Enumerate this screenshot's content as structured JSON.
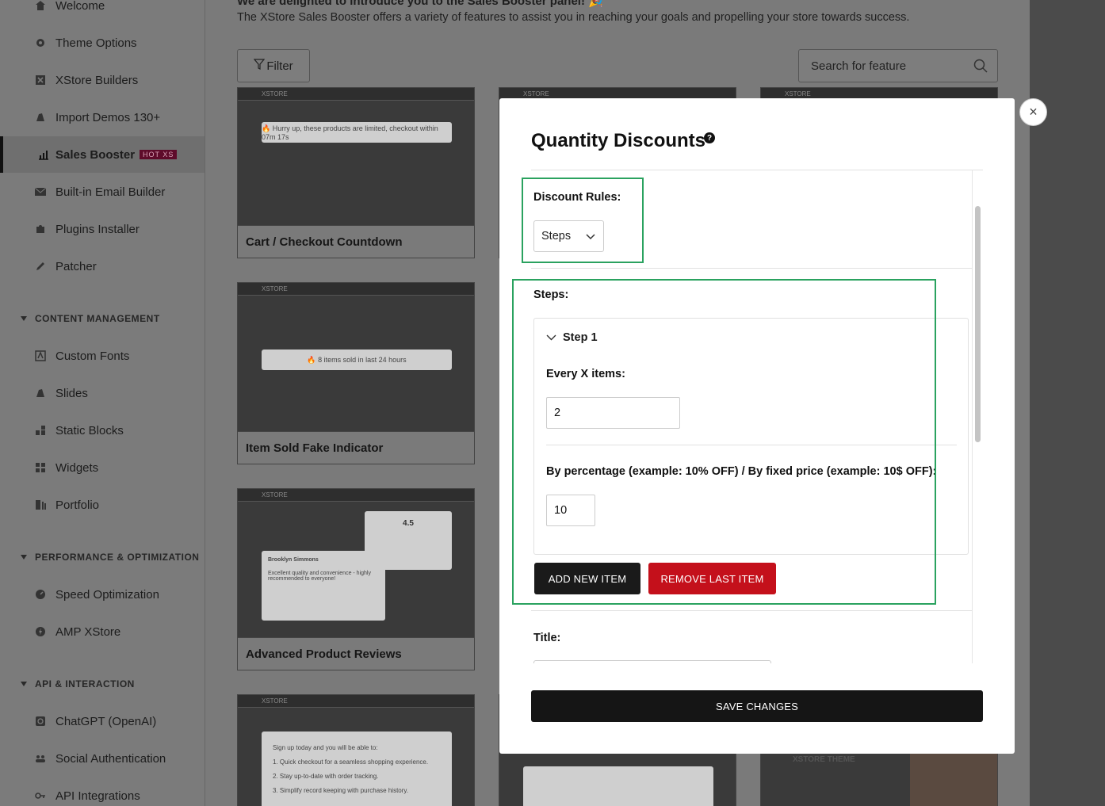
{
  "sidebar": {
    "items": [
      {
        "label": "Welcome",
        "icon": "home-icon"
      },
      {
        "label": "Theme Options",
        "icon": "gear-icon"
      },
      {
        "label": "XStore Builders",
        "icon": "x-box-icon"
      },
      {
        "label": "Import Demos 130+",
        "icon": "brush-icon"
      },
      {
        "label": "Sales Booster",
        "icon": "chart-icon",
        "badge": "HOT XS"
      },
      {
        "label": "Built-in Email Builder",
        "icon": "mail-icon"
      },
      {
        "label": "Plugins Installer",
        "icon": "puzzle-icon"
      },
      {
        "label": "Patcher",
        "icon": "pencil-icon"
      }
    ],
    "sections": [
      {
        "title": "CONTENT MANAGEMENT",
        "items": [
          {
            "label": "Custom Fonts",
            "icon": "font-icon"
          },
          {
            "label": "Slides",
            "icon": "brush-icon"
          },
          {
            "label": "Static Blocks",
            "icon": "blocks-icon"
          },
          {
            "label": "Widgets",
            "icon": "widgets-icon"
          },
          {
            "label": "Portfolio",
            "icon": "portfolio-icon"
          }
        ]
      },
      {
        "title": "PERFORMANCE & OPTIMIZATION",
        "items": [
          {
            "label": "Speed Optimization",
            "icon": "gauge-icon"
          },
          {
            "label": "AMP XStore",
            "icon": "bolt-icon"
          }
        ]
      },
      {
        "title": "API & INTERACTION",
        "items": [
          {
            "label": "ChatGPT (OpenAI)",
            "icon": "chatgpt-icon"
          },
          {
            "label": "Social Authentication",
            "icon": "users-icon"
          },
          {
            "label": "API Integrations",
            "icon": "key-icon"
          }
        ]
      }
    ]
  },
  "main": {
    "intro_heading": "We are delighted to introduce you to the Sales Booster panel! 🎉",
    "intro_text": "The XStore Sales Booster offers a variety of features to assist you in reaching your goals and propelling your store towards success.",
    "filter_label": "Filter",
    "search_placeholder": "Search for feature",
    "cards": [
      {
        "title": "Cart / Checkout Countdown",
        "preview_text": "🔥 Hurry up, these products are limited, checkout within 07m 17s"
      },
      {
        "title": "Item Sold Fake Indicator",
        "preview_text": "🔥 8 items sold in last 24 hours"
      },
      {
        "title": "Advanced Product Reviews",
        "preview_text": "Brooklyn Simmons",
        "preview_text2": "Excellent quality and convenience - highly recommended to everyone!",
        "preview_rating": "4.5"
      },
      {
        "title": "",
        "preview_text": "Sign up today and you will be able to:",
        "preview_list": [
          "1. Quick checkout for a seamless shopping experience.",
          "2. Stay up-to-date with order tracking.",
          "3. Simplify record keeping with purchase history."
        ]
      }
    ]
  },
  "modal": {
    "title": "Quantity Discounts",
    "help_icon": "?",
    "discount_rules_label": "Discount Rules:",
    "discount_rules_value": "Steps",
    "steps_label": "Steps:",
    "step_title": "Step 1",
    "every_x_label": "Every X items:",
    "every_x_value": "2",
    "percent_label": "By percentage (example: 10% OFF) / By fixed price (example: 10$ OFF):",
    "percent_value": "10",
    "add_button": "ADD NEW ITEM",
    "remove_button": "REMOVE LAST ITEM",
    "title_label": "Title:",
    "save_button": "SAVE CHANGES",
    "close_icon": "×"
  },
  "colors": {
    "highlight": "#2aa25f",
    "remove_button": "#c4101b",
    "dark_button": "#151515"
  }
}
